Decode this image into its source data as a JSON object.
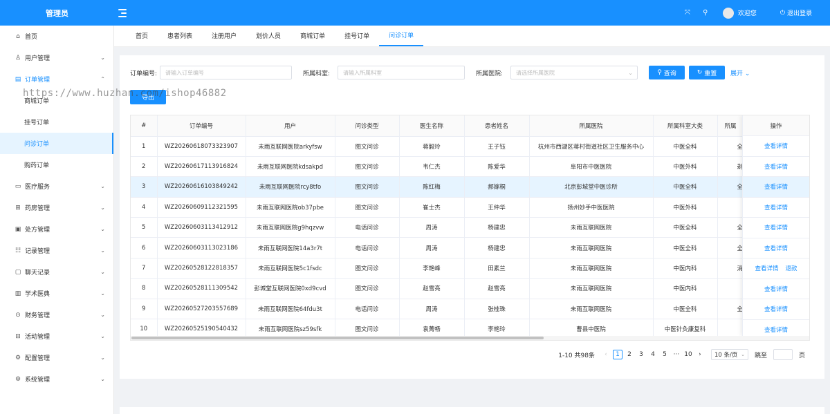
{
  "header": {
    "logo": "管理员",
    "welcome": "欢迎您",
    "logout": "退出登录"
  },
  "sidebar": {
    "items": [
      {
        "label": "首页",
        "icon": "home-icon"
      },
      {
        "label": "用户管理",
        "icon": "user-icon"
      },
      {
        "label": "订单管理",
        "icon": "order-icon"
      },
      {
        "label": "商城订单",
        "icon": ""
      },
      {
        "label": "挂号订单",
        "icon": ""
      },
      {
        "label": "问诊订单",
        "icon": ""
      },
      {
        "label": "购药订单",
        "icon": ""
      },
      {
        "label": "医疗服务",
        "icon": "monitor-icon"
      },
      {
        "label": "药房管理",
        "icon": "pharmacy-icon"
      },
      {
        "label": "处方管理",
        "icon": "prescription-icon"
      },
      {
        "label": "记录管理",
        "icon": "record-icon"
      },
      {
        "label": "聊天记录",
        "icon": "chat-icon"
      },
      {
        "label": "学术医典",
        "icon": "book-icon"
      },
      {
        "label": "财务管理",
        "icon": "finance-icon"
      },
      {
        "label": "活动管理",
        "icon": "gift-icon"
      },
      {
        "label": "配置管理",
        "icon": "config-icon"
      },
      {
        "label": "系统管理",
        "icon": "system-icon"
      }
    ]
  },
  "tabs": [
    "首页",
    "患者列表",
    "注册用户",
    "划价人员",
    "商城订单",
    "挂号订单",
    "问诊订单"
  ],
  "filters": {
    "order_no_label": "订单编号:",
    "order_no_placeholder": "请输入订单编号",
    "dept_label": "所属科室:",
    "dept_placeholder": "请输入所属科室",
    "hospital_label": "所属医院:",
    "hospital_placeholder": "请选择所属医院",
    "search_label": "查询",
    "reset_label": "重置",
    "expand_label": "展开"
  },
  "export_label": "导出",
  "watermark": "https://www.huzhan.com/ishop46882",
  "table": {
    "columns": [
      "#",
      "订单编号",
      "用户",
      "问诊类型",
      "医生名称",
      "患者姓名",
      "所属医院",
      "所属科室大类",
      "所属"
    ],
    "op_header": "操作",
    "view_label": "查看详情",
    "refund_label": "退款",
    "rows": [
      {
        "idx": "1",
        "no": "WZ20260618073323907",
        "user": "未雨互联网医院arkyfsw",
        "type": "图文问诊",
        "doctor": "蒋毅玲",
        "patient": "王子钰",
        "hospital": "杭州市西湖区蒋村街道社区卫生服务中心",
        "dept": "中医全科",
        "sub": "全"
      },
      {
        "idx": "2",
        "no": "WZ20260617113916824",
        "user": "未雨互联网医院kdsakpd",
        "type": "图文问诊",
        "doctor": "韦仁杰",
        "patient": "陈爱华",
        "hospital": "阜阳市中医医院",
        "dept": "中医外科",
        "sub": "剃"
      },
      {
        "idx": "3",
        "no": "WZ20260616103849242",
        "user": "未雨互联网医院rcy8tfo",
        "type": "图文问诊",
        "doctor": "陈红梅",
        "patient": "郝嫁桐",
        "hospital": "北京彭城堂中医诊所",
        "dept": "中医全科",
        "sub": "全"
      },
      {
        "idx": "4",
        "no": "WZ20260609112321595",
        "user": "未雨互联网医院ob37pbe",
        "type": "图文问诊",
        "doctor": "崔士杰",
        "patient": "王仲华",
        "hospital": "扬州妙手中医医院",
        "dept": "中医外科",
        "sub": ""
      },
      {
        "idx": "5",
        "no": "WZ20260603113412912",
        "user": "未雨互联网医院g9hqzvw",
        "type": "电话问诊",
        "doctor": "周涛",
        "patient": "杨建忠",
        "hospital": "未雨互联网医院",
        "dept": "中医全科",
        "sub": "全"
      },
      {
        "idx": "6",
        "no": "WZ20260603113023186",
        "user": "未雨互联网医院14a3r7t",
        "type": "电话问诊",
        "doctor": "周涛",
        "patient": "杨建忠",
        "hospital": "未雨互联网医院",
        "dept": "中医全科",
        "sub": "全"
      },
      {
        "idx": "7",
        "no": "WZ20260528122818357",
        "user": "未雨互联网医院5c1fsdc",
        "type": "图文问诊",
        "doctor": "李艳峰",
        "patient": "田素兰",
        "hospital": "未雨互联网医院",
        "dept": "中医内科",
        "sub": "消"
      },
      {
        "idx": "8",
        "no": "WZ20260528111309542",
        "user": "彭城堂互联网医院0xd9cvd",
        "type": "图文问诊",
        "doctor": "赵雪亮",
        "patient": "赵雪亮",
        "hospital": "未雨互联网医院",
        "dept": "中医内科",
        "sub": ""
      },
      {
        "idx": "9",
        "no": "WZ20260527203557689",
        "user": "未雨互联网医院64fdu3t",
        "type": "电话问诊",
        "doctor": "周涛",
        "patient": "张桂珠",
        "hospital": "未雨互联网医院",
        "dept": "中医全科",
        "sub": "全"
      },
      {
        "idx": "10",
        "no": "WZ20260525190540432",
        "user": "未雨互联网医院sz59sfk",
        "type": "图文问诊",
        "doctor": "袁菁畅",
        "patient": "李艳玲",
        "hospital": "曹县中医院",
        "dept": "中医针灸康复科",
        "sub": ""
      }
    ]
  },
  "pagination": {
    "summary": "1-10 共98条",
    "pages": [
      "1",
      "2",
      "3",
      "4",
      "5",
      "···",
      "10"
    ],
    "page_size": "10 条/页",
    "jump_label": "跳至",
    "page_suffix": "页"
  }
}
